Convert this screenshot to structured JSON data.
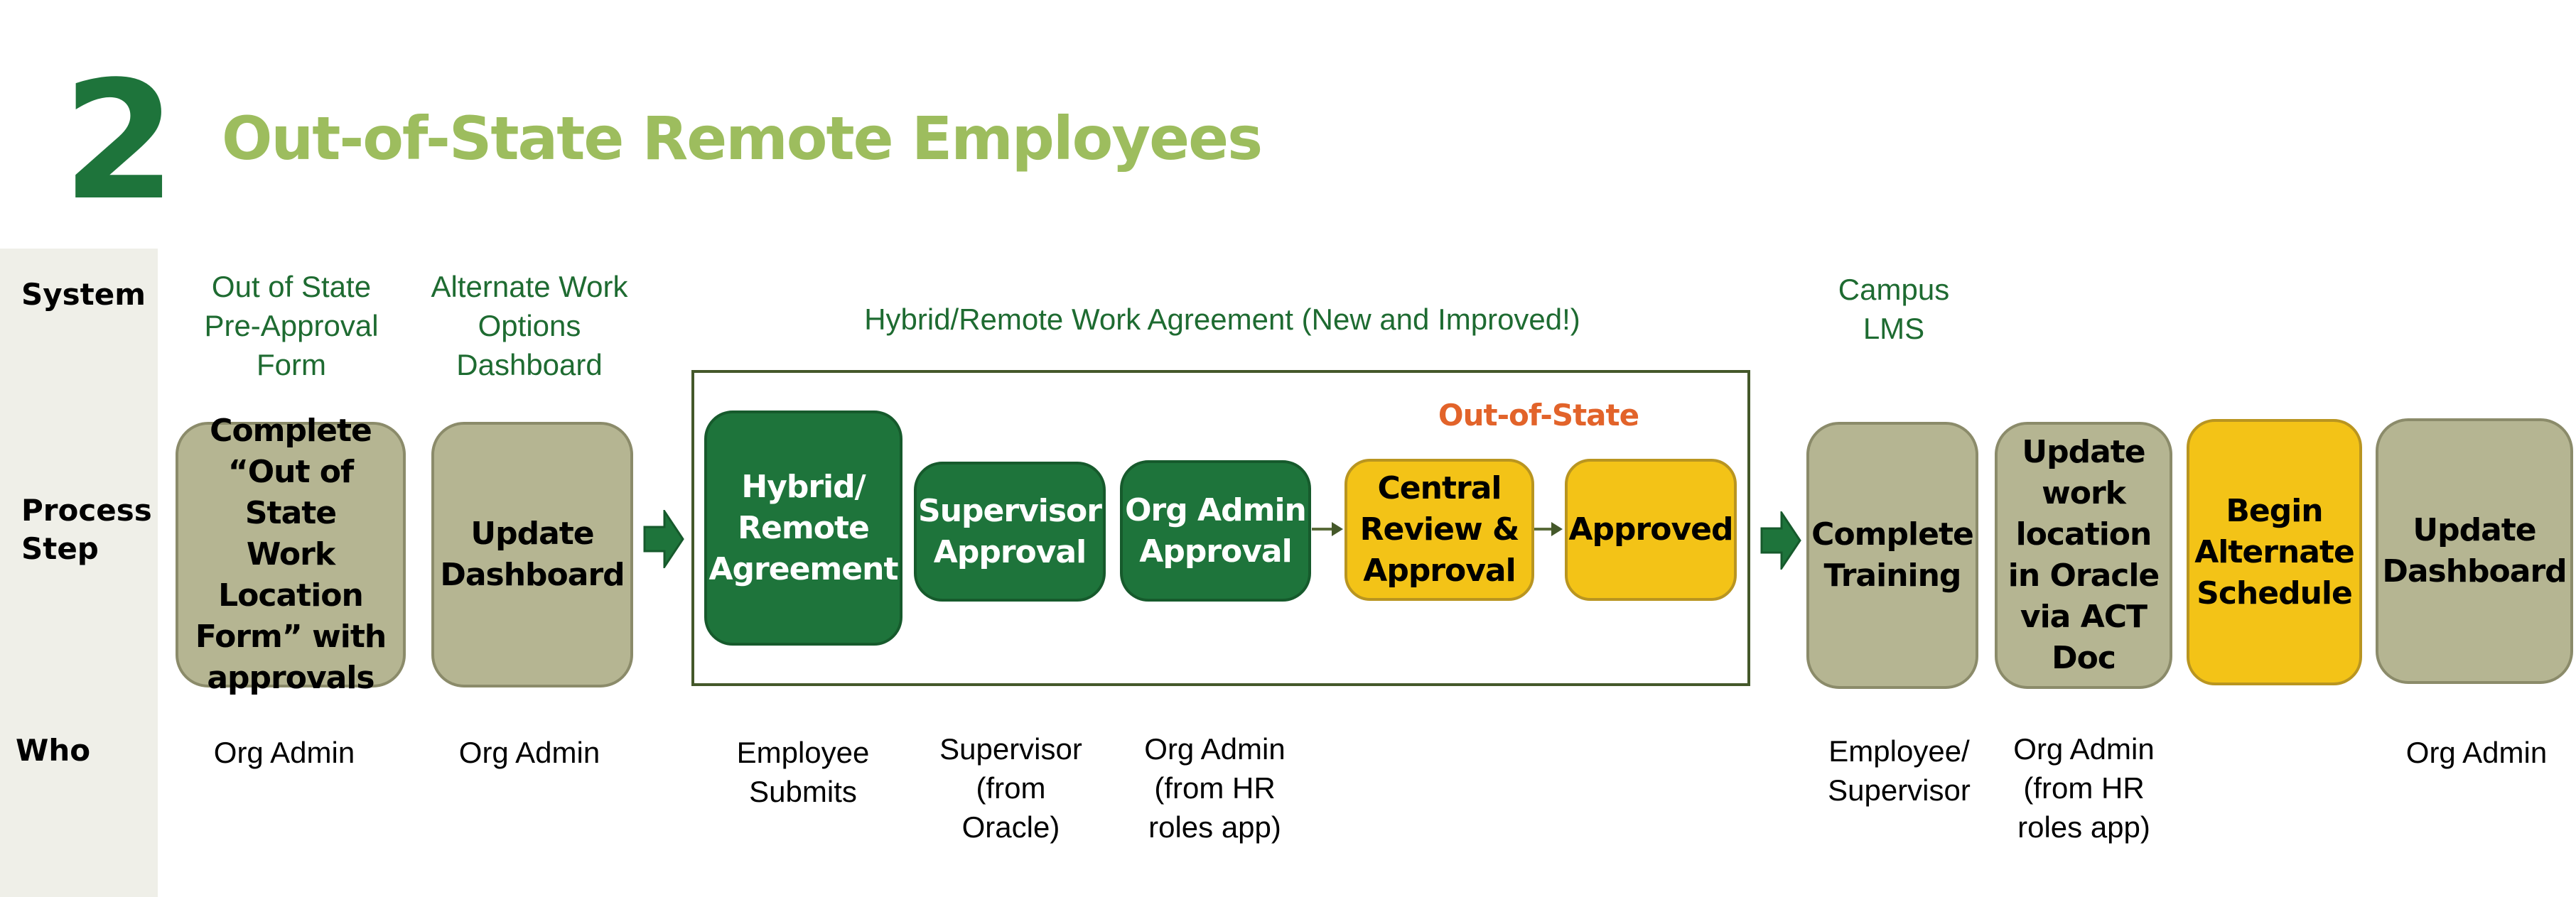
{
  "header": {
    "number": "2",
    "title": "Out-of-State Remote Employees"
  },
  "row_labels": {
    "system": "System",
    "process_step": "Process\nStep",
    "who": "Who"
  },
  "systems": {
    "pre_approval_form": "Out of State\nPre-Approval\nForm",
    "awo_dashboard": "Alternate Work\nOptions\nDashboard",
    "hybrid_agreement": "Hybrid/Remote Work Agreement (New and Improved!)",
    "campus_lms": "Campus\nLMS"
  },
  "group": {
    "out_of_state_label": "Out-of-State"
  },
  "steps": [
    {
      "label": "Complete\n“Out of State\nWork\nLocation\nForm” with\napprovals",
      "style": "tan"
    },
    {
      "label": "Update\nDashboard",
      "style": "tan"
    },
    {
      "label": "Hybrid/\nRemote\nAgreement",
      "style": "green"
    },
    {
      "label": "Supervisor\nApproval",
      "style": "green"
    },
    {
      "label": "Org Admin\nApproval",
      "style": "green"
    },
    {
      "label": "Central\nReview &\nApproval",
      "style": "yellow"
    },
    {
      "label": "Approved",
      "style": "yellow"
    },
    {
      "label": "Complete\nTraining",
      "style": "tan"
    },
    {
      "label": "Update\nwork\nlocation\nin Oracle\nvia ACT\nDoc",
      "style": "tan"
    },
    {
      "label": "Begin\nAlternate\nSchedule",
      "style": "yellow"
    },
    {
      "label": "Update\nDashboard",
      "style": "tan"
    }
  ],
  "who": [
    "Org Admin",
    "Org Admin",
    "Employee\nSubmits",
    "Supervisor\n(from\nOracle)",
    "Org Admin\n(from HR\nroles app)",
    "Employee/\nSupervisor",
    "Org Admin\n(from HR\nroles app)",
    "Org Admin"
  ],
  "colors": {
    "dark_green": "#1e743b",
    "title_green": "#9dbd5e",
    "system_text_green": "#1e6b31",
    "tan": "#b5b592",
    "yellow": "#f3c317",
    "orange": "#e2632a",
    "frame": "#44582a",
    "label_column": "#efefe8"
  }
}
